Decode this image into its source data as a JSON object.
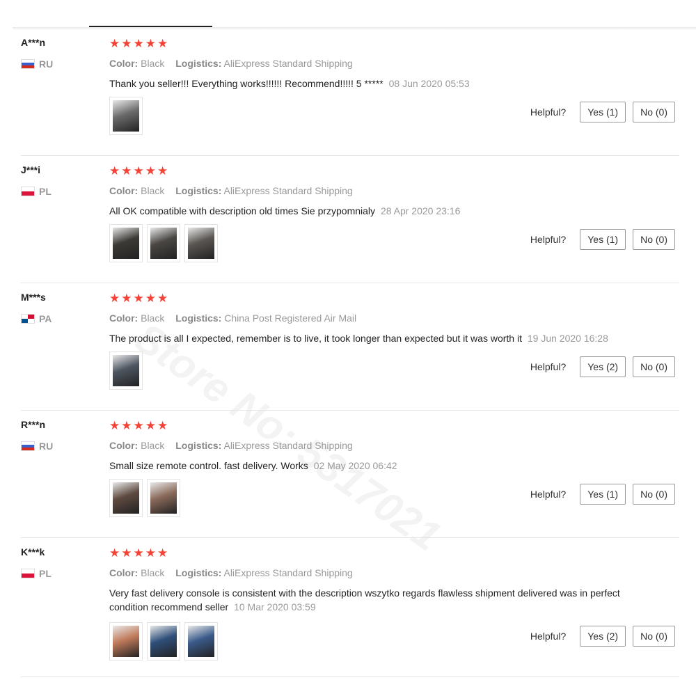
{
  "watermark": "Store No: 5317021",
  "labels": {
    "color": "Color:",
    "logistics": "Logistics:",
    "helpful": "Helpful?"
  },
  "reviews": [
    {
      "user": "A***n",
      "country": "RU",
      "flag": "ru",
      "stars": 5,
      "color": "Black",
      "logistics": "AliExpress Standard Shipping",
      "text": "Thank you seller!!! Everything works!!!!!! Recommend!!!!! 5 *****",
      "date": "08 Jun 2020 05:53",
      "yes": "Yes (1)",
      "no": "No (0)",
      "photos": [
        "#6b6b6b"
      ]
    },
    {
      "user": "J***i",
      "country": "PL",
      "flag": "pl",
      "stars": 5,
      "color": "Black",
      "logistics": "AliExpress Standard Shipping",
      "text": "All OK compatible with description old times Sie przypomnialy",
      "date": "28 Apr 2020 23:16",
      "yes": "Yes (1)",
      "no": "No (0)",
      "photos": [
        "#3c3a36",
        "#4a4744",
        "#5a5652"
      ]
    },
    {
      "user": "M***s",
      "country": "PA",
      "flag": "pa",
      "stars": 5,
      "color": "Black",
      "logistics": "China Post Registered Air Mail",
      "text": "The product is all I expected, remember is to live, it took longer than expected but it was worth it",
      "date": "19 Jun 2020 16:28",
      "yes": "Yes (2)",
      "no": "No (0)",
      "photos": [
        "#4d5560"
      ]
    },
    {
      "user": "R***n",
      "country": "RU",
      "flag": "ru",
      "stars": 5,
      "color": "Black",
      "logistics": "AliExpress Standard Shipping",
      "text": "Small size remote control. fast delivery. Works",
      "date": "02 May 2020 06:42",
      "yes": "Yes (1)",
      "no": "No (0)",
      "photos": [
        "#5e4a40",
        "#8a6a5a"
      ]
    },
    {
      "user": "K***k",
      "country": "PL",
      "flag": "pl",
      "stars": 5,
      "color": "Black",
      "logistics": "AliExpress Standard Shipping",
      "text": "Very fast delivery console is consistent with the description wszytko regards flawless shipment delivered was in perfect condition recommend seller",
      "date": "10 Mar 2020 03:59",
      "yes": "Yes (2)",
      "no": "No (0)",
      "photos": [
        "#c07a5a",
        "#2f4f7a",
        "#3a5a8a"
      ]
    }
  ]
}
